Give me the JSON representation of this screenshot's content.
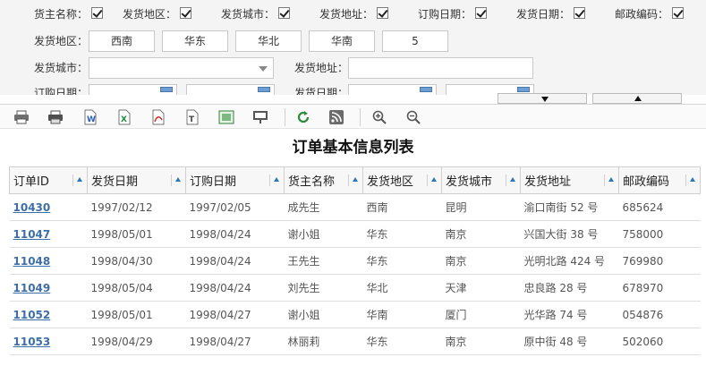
{
  "filters": {
    "checkboxes": [
      {
        "label": "货主名称：",
        "checked": true
      },
      {
        "label": "发货地区：",
        "checked": true
      },
      {
        "label": "发货城市：",
        "checked": true
      },
      {
        "label": "发货地址：",
        "checked": true
      },
      {
        "label": "订购日期：",
        "checked": true
      },
      {
        "label": "发货日期：",
        "checked": true
      },
      {
        "label": "邮政编码：",
        "checked": true
      }
    ],
    "region_label": "发货地区：",
    "region_values": [
      "西南",
      "华东",
      "华北",
      "华南",
      "5"
    ],
    "city_label": "发货城市：",
    "city_value": "",
    "address_label": "发货地址：",
    "address_value": "",
    "order_date_label": "订购日期：",
    "ship_date_label": "发货日期："
  },
  "toolbar": {
    "icons": [
      "print-icon",
      "print-preview-icon",
      "export-word-icon",
      "export-excel-icon",
      "export-pdf-icon",
      "export-text-icon",
      "export-image-icon",
      "slideshow-icon",
      "refresh-icon",
      "rss-icon",
      "zoom-in-icon",
      "zoom-out-icon"
    ]
  },
  "table": {
    "title": "订单基本信息列表",
    "columns": [
      "订单ID",
      "发货日期",
      "订购日期",
      "货主名称",
      "发货地区",
      "发货城市",
      "发货地址",
      "邮政编码"
    ],
    "rows": [
      [
        "10430",
        "1997/02/12",
        "1997/02/05",
        "成先生",
        "西南",
        "昆明",
        "渝口南街 52 号",
        "685624"
      ],
      [
        "11047",
        "1998/05/01",
        "1998/04/24",
        "谢小姐",
        "华东",
        "南京",
        "兴国大街 38 号",
        "758000"
      ],
      [
        "11048",
        "1998/04/30",
        "1998/04/24",
        "王先生",
        "华东",
        "南京",
        "光明北路 424 号",
        "769980"
      ],
      [
        "11049",
        "1998/05/04",
        "1998/04/24",
        "刘先生",
        "华北",
        "天津",
        "忠良路 28 号",
        "678970"
      ],
      [
        "11052",
        "1998/05/01",
        "1998/04/27",
        "谢小姐",
        "华南",
        "厦门",
        "光华路 74 号",
        "054876"
      ],
      [
        "11053",
        "1998/04/29",
        "1998/04/27",
        "林丽莉",
        "华东",
        "南京",
        "原中街 48 号",
        "502060"
      ]
    ]
  },
  "colors": {
    "link": "#3e6ea8",
    "sort_arrow": "#2f74b8",
    "panel_bg": "#f4f4f4"
  }
}
